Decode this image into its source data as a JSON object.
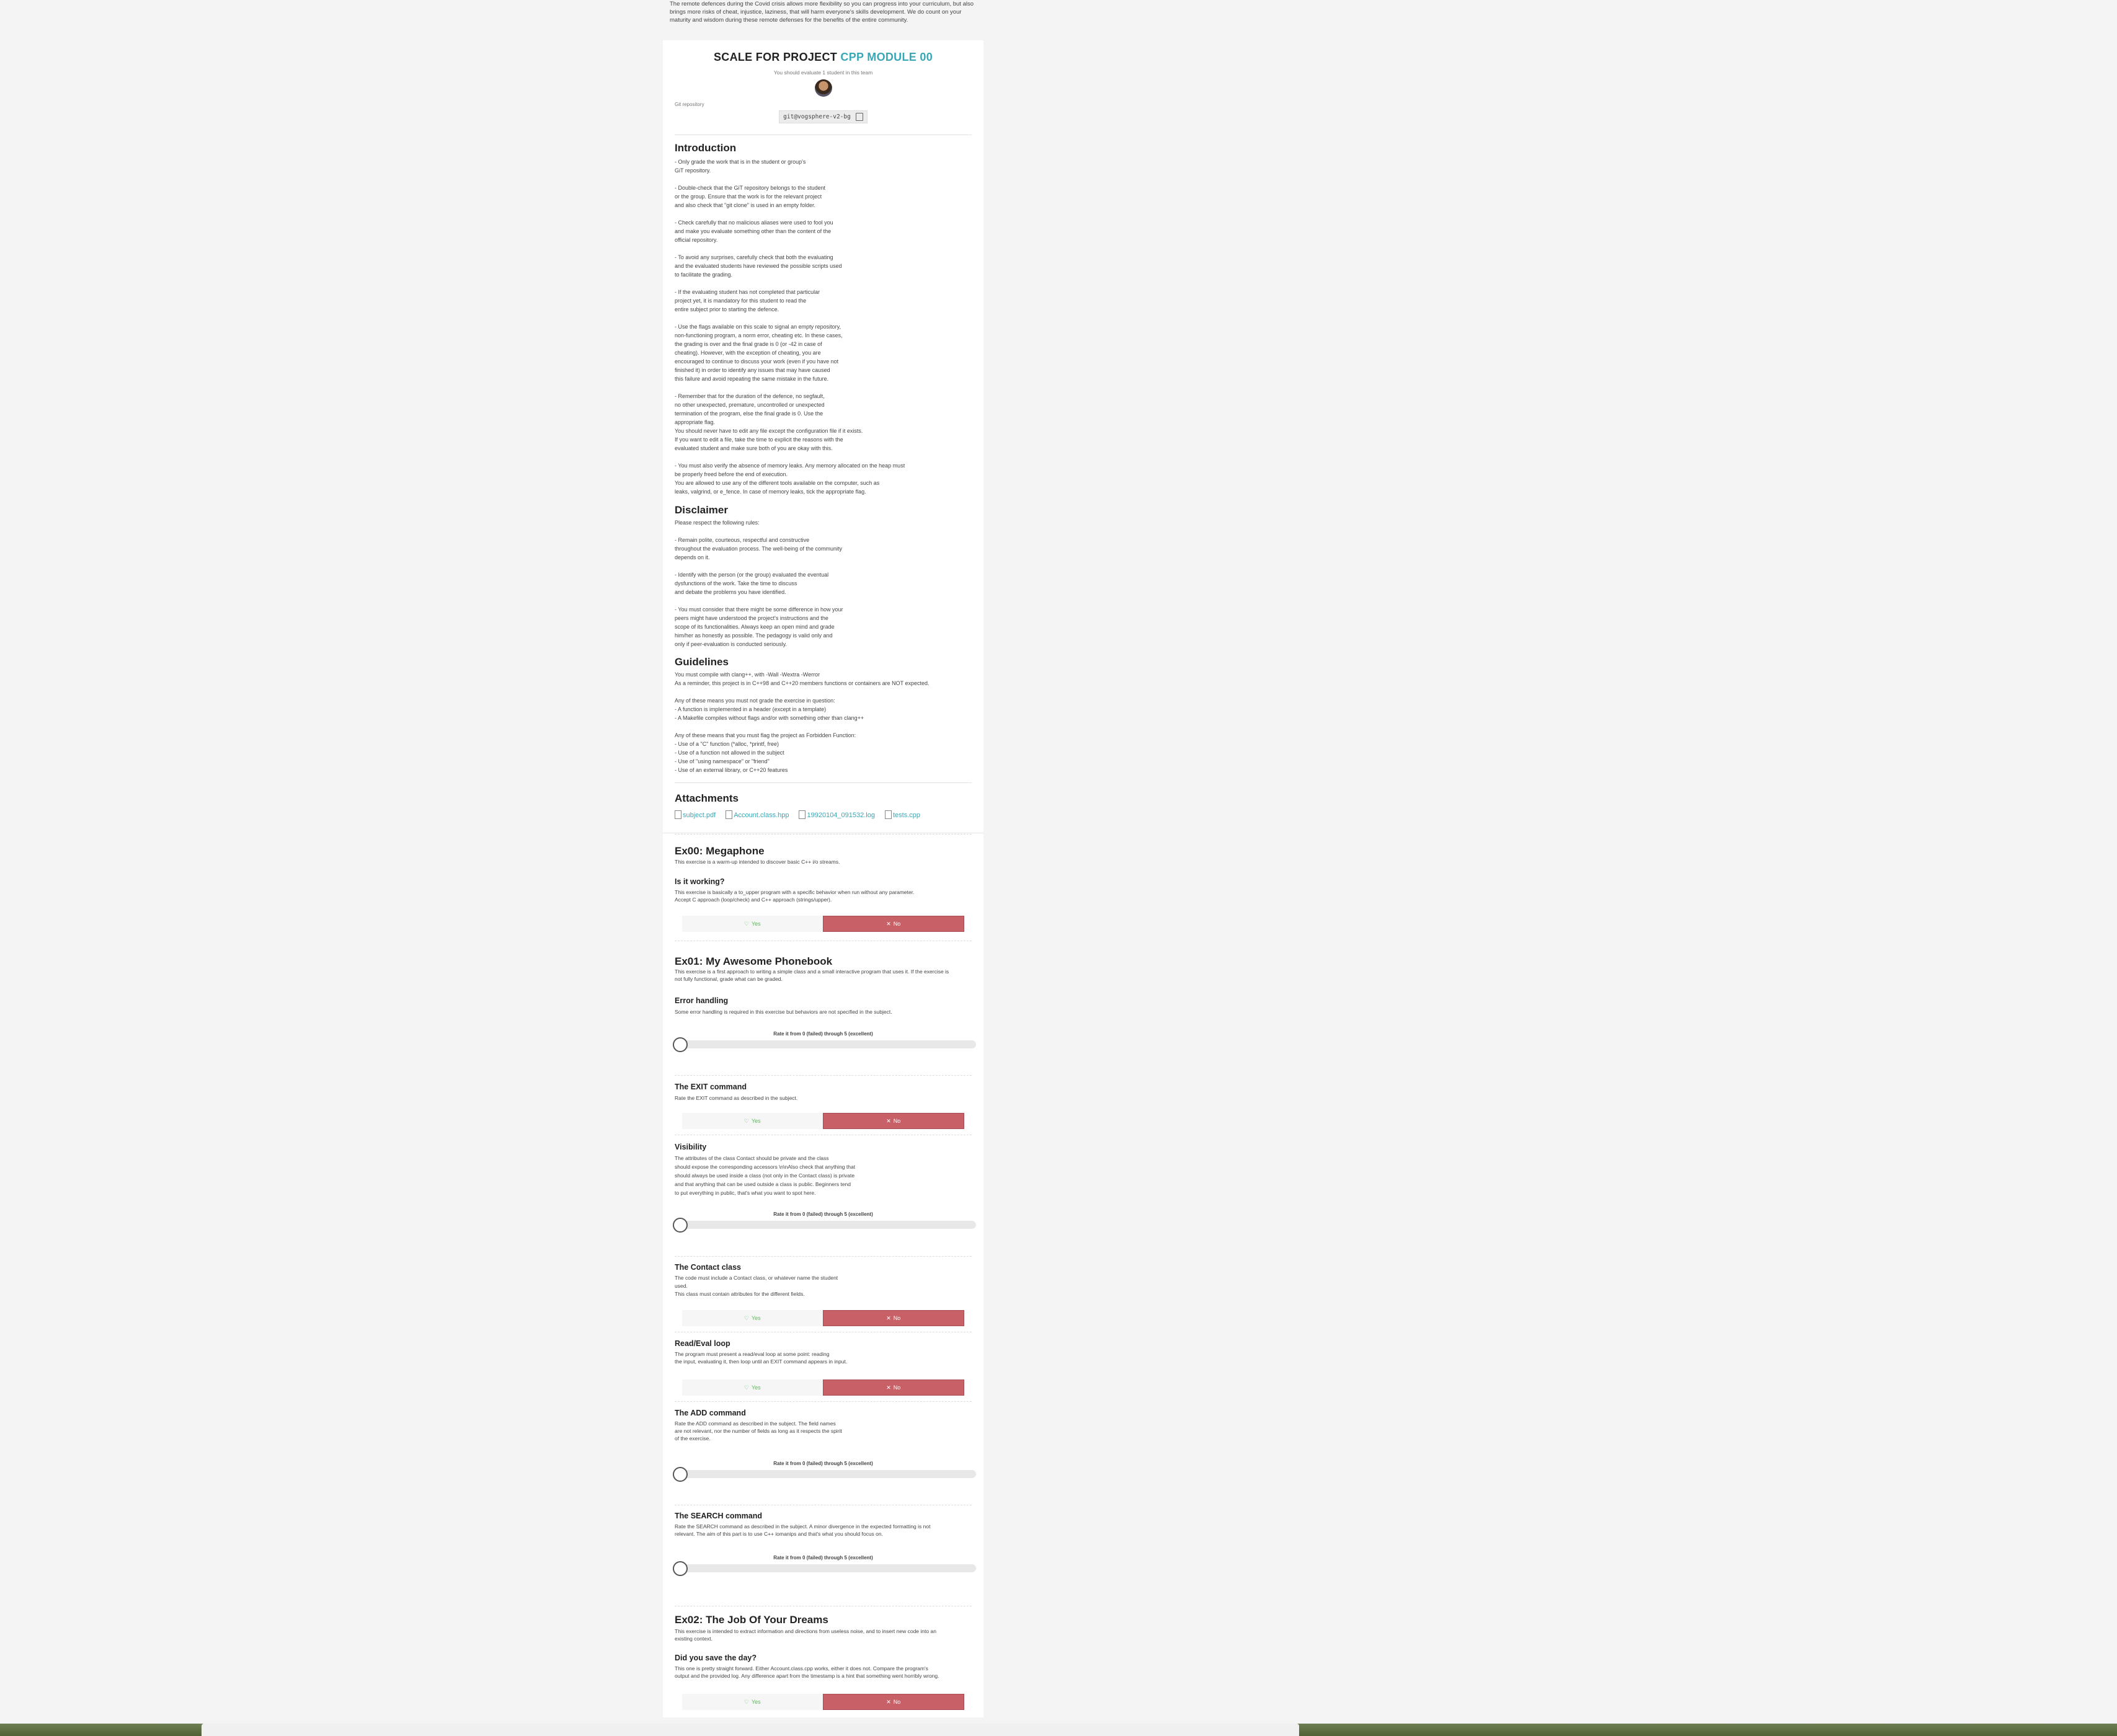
{
  "top_note": "The remote defences during the Covid crisis allows more flexibility so you can progress into your curriculum, but also brings more risks of cheat, injustice, laziness, that will harm everyone's skills development. We do count on your maturity and wisdom during these remote defenses for the benefits of the entire community.",
  "header": {
    "scale_prefix": "SCALE FOR PROJECT",
    "project": "CPP MODULE 00",
    "evaluate_note": "You should evaluate 1 student in this team",
    "git_label": "Git repository",
    "git_url": "git@vogsphere-v2-bg"
  },
  "introduction": {
    "title": "Introduction",
    "text": "- Only grade the work that is in the student or group's\nGiT repository.\n\n- Double-check that the GiT repository belongs to the student\nor the group. Ensure that the work is for the relevant project\nand also check that \"git clone\" is used in an empty folder.\n\n- Check carefully that no malicious aliases were used to fool you\nand make you evaluate something other than the content of the\nofficial repository.\n\n- To avoid any surprises, carefully check that both the evaluating\nand the evaluated students have reviewed the possible scripts used\nto facilitate the grading.\n\n- If the evaluating student has not completed that particular\nproject yet, it is mandatory for this student to read the\nentire subject prior to starting the defence.\n\n- Use the flags available on this scale to signal an empty repository,\nnon-functioning program, a norm error, cheating etc. In these cases,\nthe grading is over and the final grade is 0 (or -42 in case of\ncheating). However, with the exception of cheating, you are\nencouraged to continue to discuss your work (even if you have not\nfinished it) in order to identify any issues that may have caused\nthis failure and avoid repeating the same mistake in the future.\n\n- Remember that for the duration of the defence, no segfault,\nno other unexpected, premature, uncontrolled or unexpected\ntermination of the program, else the final grade is 0. Use the\nappropriate flag.\nYou should never have to edit any file except the configuration file if it exists.\nIf you want to edit a file, take the time to explicit the reasons with the\nevaluated student and make sure both of you are okay with this.\n\n- You must also verify the absence of memory leaks. Any memory allocated on the heap must\nbe properly freed before the end of execution.\nYou are allowed to use any of the different tools available on the computer, such as\nleaks, valgrind, or e_fence. In case of memory leaks, tick the appropriate flag."
  },
  "disclaimer": {
    "title": "Disclaimer",
    "text": "Please respect the following rules:\n\n- Remain polite, courteous, respectful and constructive\nthroughout the evaluation process. The well-being of the community\ndepends on it.\n\n- Identify with the person (or the group) evaluated the eventual\ndysfunctions of the work. Take the time to discuss\nand debate the problems you have identified.\n\n- You must consider that there might be some difference in how your\npeers might have understood the project's instructions and the\nscope of its functionalities. Always keep an open mind and grade\nhim/her as honestly as possible. The pedagogy is valid only and\nonly if peer-evaluation is conducted seriously."
  },
  "guidelines": {
    "title": "Guidelines",
    "text": "You must compile with clang++, with -Wall -Wextra -Werror\nAs a reminder, this project is in C++98 and C++20 members functions or containers are NOT expected.\n\nAny of these means you must not grade the exercise in question:\n- A function is implemented in a header (except in a template)\n- A Makefile compiles without flags and/or with something other than clang++\n\nAny of these means that you must flag the project as Forbidden Function:\n- Use of a \"C\" function (*alloc, *printf, free)\n- Use of a function not allowed in the subject\n- Use of \"using namespace\" or \"friend\"\n- Use of an external library, or C++20 features"
  },
  "attachments": {
    "title": "Attachments",
    "files": [
      "subject.pdf",
      "Account.class.hpp",
      "19920104_091532.log",
      "tests.cpp"
    ]
  },
  "buttons": {
    "yes": "Yes",
    "no": "No"
  },
  "rating_label": "Rate it from 0 (failed) through 5 (excellent)",
  "ex00": {
    "title": "Ex00: Megaphone",
    "desc": "This exercise is a warm-up intended to discover basic C++ i/o streams.",
    "q1_title": "Is it working?",
    "q1_text": "This exercise is basically a to_upper program with a specific behavior when run without any parameter.\nAccept C approach (loop/check) and C++ approach (strings/upper)."
  },
  "ex01": {
    "title": "Ex01: My Awesome Phonebook",
    "desc": "This exercise is a first approach to writing a simple class and a small interactive program that uses it. If the exercise is\nnot fully functional, grade what can be graded.",
    "questions": [
      {
        "title": "Error handling",
        "text": "Some error handling is required in this exercise but behaviors are not specified in the subject.",
        "type": "rating",
        "value": 0
      },
      {
        "title": "The EXIT command",
        "text": "Rate the EXIT command as described in the subject.",
        "type": "yesno",
        "selected": "No"
      },
      {
        "title": "Visibility",
        "text": "The attributes of the class Contact should be private and the class\nshould expose the corresponding accessors \\n\\nAlso check that anything that\nshould always be used inside a class (not only in the Contact class) is private\nand that anything that can be used outside a class is public. Beginners tend\nto put everything in public, that's what you want to spot here.",
        "type": "rating",
        "value": 0
      },
      {
        "title": "The Contact class",
        "text": "The code must include a Contact class, or whatever name the student\nused.\nThis class must contain attributes for the different fields.",
        "type": "yesno",
        "selected": "No"
      },
      {
        "title": "Read/Eval loop",
        "text": "The program must present a read/eval loop at some point: reading\nthe input, evaluating it, then loop until an EXIT command appears in input.",
        "type": "yesno",
        "selected": "No"
      },
      {
        "title": "The ADD command",
        "text": "Rate the ADD command as described in the subject. The field names\nare not relevant, nor the number of fields as long as it respects the spirit\nof the exercise.",
        "type": "rating",
        "value": 0
      },
      {
        "title": "The SEARCH command",
        "text": "Rate the SEARCH command as described in the subject. A minor divergence in the expected formatting is not\nrelevant. The aim of this part is to use C++ iomanips and that's what you should focus on.",
        "type": "rating",
        "value": 0
      }
    ]
  },
  "ex02": {
    "title": "Ex02: The Job Of Your Dreams",
    "desc": "This exercise is intended to extract information and directions from useless noise, and to insert new code into an\nexisting context.",
    "q1_title": "Did you save the day?",
    "q1_text": "This one is pretty straight forward. Either Account.class.cpp works, either it does not. Compare the program's\noutput and the provided log. Any difference apart from the timestamp is a hint that something went horribly wrong."
  },
  "colors": {
    "accent": "#3aa7b6",
    "no": "#c86068",
    "yes": "#5cb85c"
  }
}
